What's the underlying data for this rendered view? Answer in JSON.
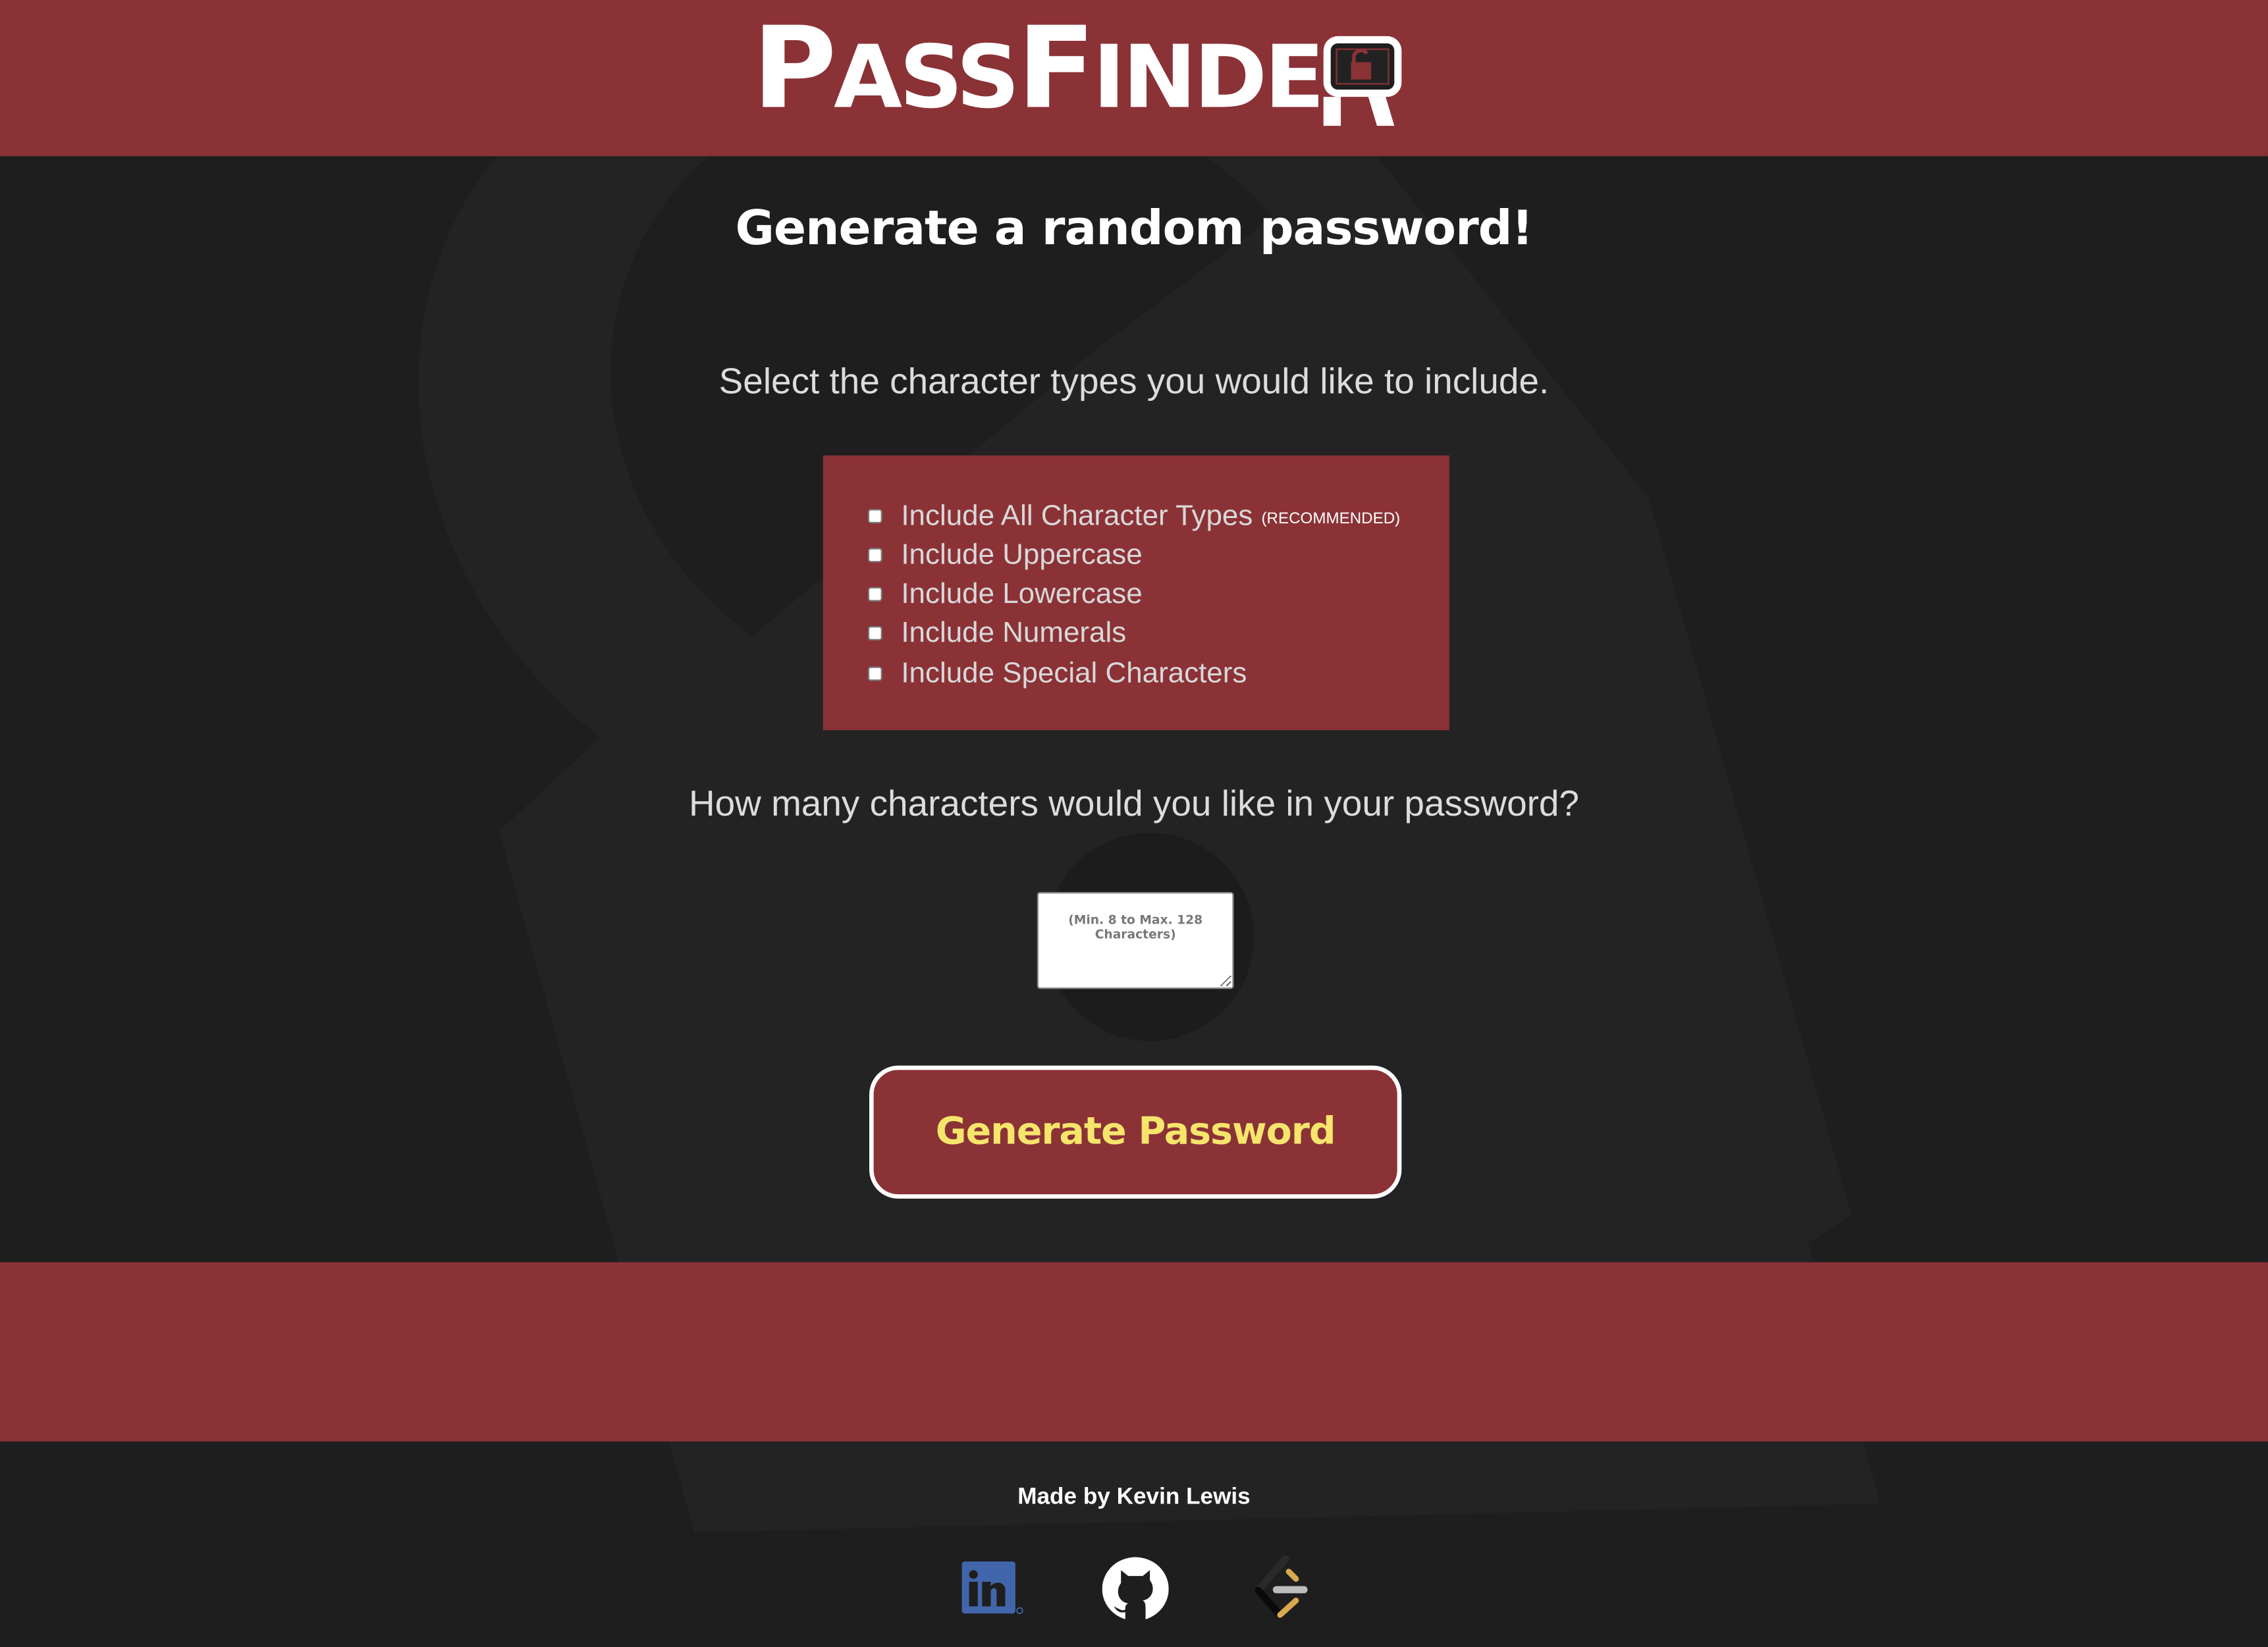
{
  "header": {
    "logo_text": "PassFinder",
    "logo_parts": [
      "P",
      "ASS",
      "F",
      "INDE"
    ]
  },
  "main": {
    "title": "Generate a random password!",
    "select_prompt": "Select the character types you would like to include.",
    "options": [
      {
        "label": "Include All Character Types",
        "note": "(RECOMMENDED)",
        "checked": false
      },
      {
        "label": "Include Uppercase",
        "checked": false
      },
      {
        "label": "Include Lowercase",
        "checked": false
      },
      {
        "label": "Include Numerals",
        "checked": false
      },
      {
        "label": "Include Special Characters",
        "checked": false
      }
    ],
    "length_prompt": "How many characters would you like in your password?",
    "length_input": {
      "value": "",
      "placeholder": "(Min. 8 to Max. 128 Characters)"
    },
    "generate_label": "Generate Password"
  },
  "footer": {
    "credit": "Made by Kevin Lewis",
    "links": [
      {
        "icon": "linkedin-icon"
      },
      {
        "icon": "github-icon"
      },
      {
        "icon": "leetcode-icon"
      }
    ]
  },
  "colors": {
    "brand": "#8b3237",
    "background": "#1e1e1e",
    "button_text": "#f6e56b"
  }
}
